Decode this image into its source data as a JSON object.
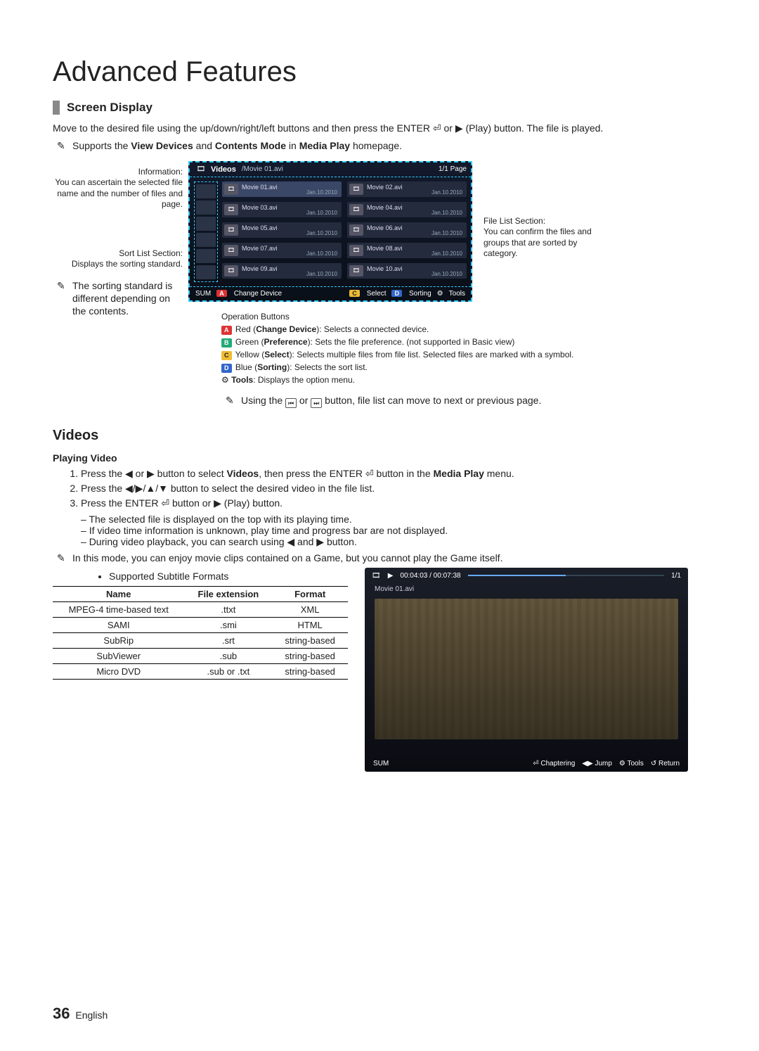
{
  "page_title": "Advanced Features",
  "section_screen_display": "Screen Display",
  "intro_text": "Move to the desired file using the up/down/right/left buttons and then press the ENTER ⏎ or ▶ (Play) button. The file is played.",
  "supports_note": "Supports the <b>View Devices</b> and <b>Contents Mode</b> in <b>Media Play</b> homepage.",
  "left_annotations": {
    "info_title": "Information:",
    "info_body": "You can ascertain the selected file name and the number of files and page.",
    "sort_title": "Sort List Section:",
    "sort_body": "Displays the sorting standard.",
    "sort_note": "The sorting standard is different depending on the contents."
  },
  "right_annotation": {
    "title": "File List Section:",
    "body": "You can confirm the files and groups that are sorted by category."
  },
  "tv": {
    "category": "Videos",
    "path": "/Movie 01.avi",
    "pager": "1/1 Page",
    "files": [
      {
        "name": "Movie 01.avi",
        "date": "Jan.10.2010"
      },
      {
        "name": "Movie 02.avi",
        "date": "Jan.10.2010"
      },
      {
        "name": "Movie 03.avi",
        "date": "Jan.10.2010"
      },
      {
        "name": "Movie 04.avi",
        "date": "Jan.10.2010"
      },
      {
        "name": "Movie 05.avi",
        "date": "Jan.10.2010"
      },
      {
        "name": "Movie 06.avi",
        "date": "Jan.10.2010"
      },
      {
        "name": "Movie 07.avi",
        "date": "Jan.10.2010"
      },
      {
        "name": "Movie 08.avi",
        "date": "Jan.10.2010"
      },
      {
        "name": "Movie 09.avi",
        "date": "Jan.10.2010"
      },
      {
        "name": "Movie 10.avi",
        "date": "Jan.10.2010"
      }
    ],
    "bottom": {
      "sum": "SUM",
      "change_device": "Change Device",
      "select": "Select",
      "sorting": "Sorting",
      "tools": "Tools"
    }
  },
  "op_buttons": {
    "heading": "Operation Buttons",
    "lines": [
      "<span class='badge a'>A</span> Red (<b>Change Device</b>): Selects a connected device.",
      "<span class='badge b'>B</span> Green (<b>Preference</b>): Sets the file preference. (not supported in Basic view)",
      "<span class='badge c'>C</span> Yellow (<b>Select</b>): Selects multiple files from file list. Selected files are marked with a symbol.",
      "<span class='badge d'>D</span> Blue (<b>Sorting</b>): Selects the sort list.",
      "⚙ <b>Tools</b>: Displays the option menu."
    ],
    "note": "Using the <span class='icon-sq'>⏮</span> or <span class='icon-sq'>⏭</span> button, file list can move to next or previous page."
  },
  "videos_heading": "Videos",
  "playing_video_heading": "Playing Video",
  "steps": [
    "Press the ◀ or ▶ button to select <b>Videos</b>, then press the ENTER ⏎ button in the <b>Media Play</b> menu.",
    "Press the ◀/▶/▲/▼ button to select the desired video in the file list.",
    "Press the ENTER ⏎ button or ▶ (Play) button."
  ],
  "step_dashes": [
    "The selected file is displayed on the top with its playing time.",
    "If video time information is unknown, play time and progress bar are not displayed.",
    "During video playback, you can search using ◀ and ▶ button."
  ],
  "mode_note": "In this mode, you can enjoy movie clips contained on a Game, but you cannot play the Game itself.",
  "supported_formats_label": "Supported Subtitle Formats",
  "table": {
    "headers": [
      "Name",
      "File extension",
      "Format"
    ],
    "rows": [
      [
        "MPEG-4 time-based text",
        ".ttxt",
        "XML"
      ],
      [
        "SAMI",
        ".smi",
        "HTML"
      ],
      [
        "SubRip",
        ".srt",
        "string-based"
      ],
      [
        "SubViewer",
        ".sub",
        "string-based"
      ],
      [
        "Micro DVD",
        ".sub or .txt",
        "string-based"
      ]
    ]
  },
  "player": {
    "time": "00:04:03 / 00:07:38",
    "pager": "1/1",
    "file": "Movie 01.avi",
    "sum": "SUM",
    "controls": [
      "⏎ Chaptering",
      "◀▶ Jump",
      "⚙ Tools",
      "↺ Return"
    ]
  },
  "footer": {
    "page": "36",
    "lang": "English"
  }
}
